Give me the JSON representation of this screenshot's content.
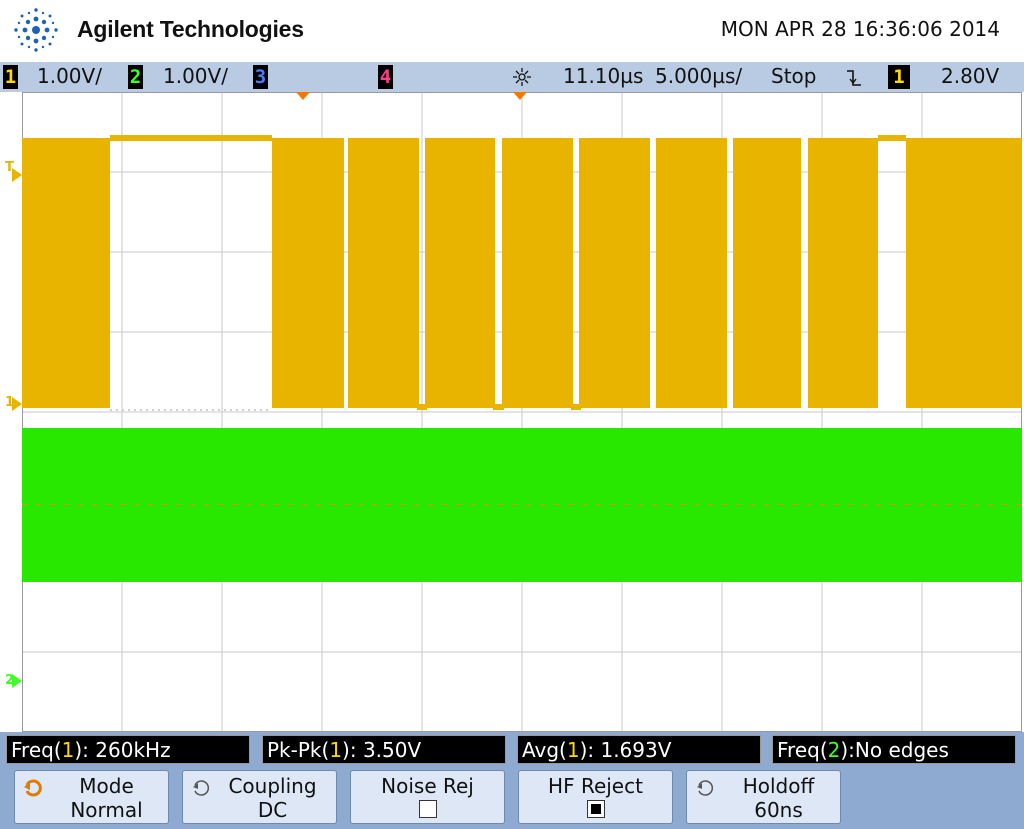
{
  "header": {
    "brand": "Agilent Technologies",
    "datetime": "MON APR 28 16:36:06 2014"
  },
  "status": {
    "ch1": {
      "num": "1",
      "scale": "1.00V/",
      "color": "#ffd800"
    },
    "ch2": {
      "num": "2",
      "scale": "1.00V/",
      "color": "#41ff27"
    },
    "ch3": {
      "num": "3",
      "color": "#4a7cff"
    },
    "ch4": {
      "num": "4",
      "color": "#ff3e8a"
    },
    "delay": "11.10µs",
    "timebase": "5.000µs/",
    "run_state": "Stop",
    "trigger_channel": "1",
    "trigger_level": "2.80V",
    "icons": [
      "horizontal-reference-icon",
      "falling-edge-trigger-icon"
    ]
  },
  "markers": {
    "trigger_level": "T",
    "ch1_ground": "1",
    "ch2_ground": "2"
  },
  "measurements": {
    "m1": {
      "prefix": "Freq(",
      "ch": "1",
      "suffix": "): 260kHz"
    },
    "m2": {
      "prefix": "Pk-Pk(",
      "ch": "1",
      "suffix": "): 3.50V"
    },
    "m3": {
      "prefix": "Avg(",
      "ch": "1",
      "suffix": "): 1.693V"
    },
    "m4": {
      "prefix": "Freq(",
      "ch": "2",
      "suffix": "):No edges"
    }
  },
  "softkeys": [
    {
      "line1": "Mode",
      "line2": "Normal",
      "icon": "rotary-knob-icon",
      "active": true
    },
    {
      "line1": "Coupling",
      "line2": "DC",
      "icon": "rotary-knob-icon",
      "active": false
    },
    {
      "line1": "Noise Rej",
      "checkbox": false
    },
    {
      "line1": "HF Reject",
      "checkbox": true
    },
    {
      "line1": "Holdoff",
      "line2": "60ns",
      "icon": "rotary-knob-icon",
      "active": false
    }
  ],
  "colors": {
    "ch1_trace": "#e9b400",
    "ch2_trace": "#29e800",
    "statusbar": "#b9cbe3",
    "softkey_bar": "#8faad0",
    "knob_active": "#e07a00"
  }
}
